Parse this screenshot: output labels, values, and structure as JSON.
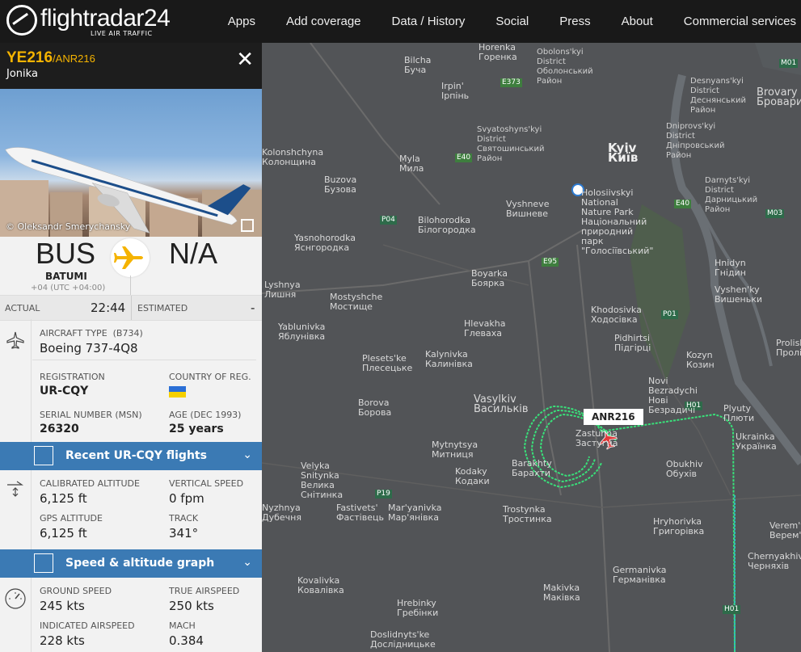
{
  "nav": {
    "logo_text": "flightradar24",
    "logo_sub": "LIVE AIR TRAFFIC",
    "links": [
      "Apps",
      "Add coverage",
      "Data / History",
      "Social",
      "Press",
      "About",
      "Commercial services"
    ]
  },
  "flight": {
    "callsign": "YE216",
    "alt_callsign": "/ANR216",
    "operator": "Jonika",
    "photo_credit": "© Oleksandr Smerychansky",
    "origin_code": "BUS",
    "origin_city": "BATUMI",
    "origin_tz": "+04 (UTC +04:00)",
    "dest_code": "N/A",
    "actual_label": "ACTUAL",
    "actual_time": "22:44",
    "estimated_label": "ESTIMATED",
    "estimated_time": "-"
  },
  "aircraft": {
    "type_label": "AIRCRAFT TYPE",
    "type_code": "(B734)",
    "type_value": "Boeing 737-4Q8",
    "registration_label": "REGISTRATION",
    "registration": "UR-CQY",
    "country_label": "COUNTRY OF REG.",
    "msn_label": "SERIAL NUMBER (MSN)",
    "msn": "26320",
    "age_label": "AGE (DEC 1993)",
    "age": "25 years"
  },
  "recent_flights_bar": "Recent UR-CQY flights",
  "altitude": {
    "cal_alt_label": "CALIBRATED ALTITUDE",
    "cal_alt": "6,125 ft",
    "vs_label": "VERTICAL SPEED",
    "vs": "0 fpm",
    "gps_alt_label": "GPS ALTITUDE",
    "gps_alt": "6,125 ft",
    "track_label": "TRACK",
    "track": "341°"
  },
  "graph_bar": "Speed & altitude graph",
  "speed": {
    "gs_label": "GROUND SPEED",
    "gs": "245 kts",
    "tas_label": "TRUE AIRSPEED",
    "tas": "250 kts",
    "ias_label": "INDICATED AIRSPEED",
    "ias": "228 kts",
    "mach_label": "MACH",
    "mach": "0.384"
  },
  "map": {
    "aircraft_label": "ANR216",
    "places": [
      {
        "t": "Horenka\nГоренка"
      },
      {
        "t": "Obolons'kyi\nDistrict\nОболонський\nРайон"
      },
      {
        "t": "Desnyans'kyi\nDistrict\nДеснянський\nРайон"
      },
      {
        "t": "Brovary\nБровари"
      },
      {
        "t": "Bilcha\nБуча"
      },
      {
        "t": "Irpin'\nІрпінь"
      },
      {
        "t": "Svyatoshyns'kyi\nDistrict\nСвятошинський\nРайон"
      },
      {
        "t": "Kyiv\nКиїв"
      },
      {
        "t": "Dniprovs'kyi\nDistrict\nДніпровський\nРайон"
      },
      {
        "t": "Holosiivskyi\nNational\nNature Park\nНаціональний\nприродний\nпарк\n\"Голосіївський\""
      },
      {
        "t": "Vyshneve\nВишневе"
      },
      {
        "t": "Buzova\nБузова"
      },
      {
        "t": "Myla\nМила"
      },
      {
        "t": "Kolonshchyna\nКолонщина"
      },
      {
        "t": "Bilohorodka\nБілогородка"
      },
      {
        "t": "Yasnohorodka\nЯснгородка"
      },
      {
        "t": "Boyarka\nБоярка"
      },
      {
        "t": "Lyshnya\nЛишня"
      },
      {
        "t": "Mostyshche\nМостище"
      },
      {
        "t": "Khodosivka\nХодосівка"
      },
      {
        "t": "Yablunivka\nЯблунівка"
      },
      {
        "t": "Hlevakha\nГлеваха"
      },
      {
        "t": "Pidhirtsi\nПідгірці"
      },
      {
        "t": "Plesets'ke\nПлесецьке"
      },
      {
        "t": "Kalynivka\nКалинівка"
      },
      {
        "t": "Kozyn\nКозин"
      },
      {
        "t": "Novi\nBezradychi\nНові\nБезрадичі"
      },
      {
        "t": "Borova\nБорова"
      },
      {
        "t": "Vasylkiv\nВасильків"
      },
      {
        "t": "Plyuty\nПлюти"
      },
      {
        "t": "Ukrainka\nУкраїнка"
      },
      {
        "t": "Mytnytsya\nМитниця"
      },
      {
        "t": "Zastuhna\nЗастугна"
      },
      {
        "t": "Barakhty\nБарахти"
      },
      {
        "t": "Velyka\nSnitynka\nВелика\nСнітинка"
      },
      {
        "t": "Kodaky\nКодаки"
      },
      {
        "t": "Obukhiv\nОбухів"
      },
      {
        "t": "Fastivets'\nФастівець"
      },
      {
        "t": "Mar'yanivka\nМар'янівка"
      },
      {
        "t": "Trostynka\nТростинка"
      },
      {
        "t": "Nyzhnya\nДубечня"
      },
      {
        "t": "Hryhorivka\nГригорівка"
      },
      {
        "t": "Germanivka\nГерманівка"
      },
      {
        "t": "Chernyakhiv\nЧерняхів"
      },
      {
        "t": "Kovalivka\nКовалівка"
      },
      {
        "t": "Makivka\nМаківка"
      },
      {
        "t": "Hrebinky\nГребінки"
      },
      {
        "t": "Doslidnyts'ke\nДослідницьке"
      },
      {
        "t": "Hnidyn\nГнідин"
      },
      {
        "t": "Vyshen'ky\nВишеньки"
      },
      {
        "t": "Darnyts'kyi\nDistrict\nДарницький\nРайон"
      },
      {
        "t": "Prolisky\nПроліски"
      },
      {
        "t": "Verem'ya\nВерем'я"
      }
    ],
    "roads": [
      "M01",
      "E373",
      "E40",
      "M03",
      "P04",
      "E95",
      "P01",
      "H01",
      "P19",
      "E40"
    ]
  },
  "colors": {
    "track": "#39e07a",
    "aircraft": "#e03a3a",
    "accent": "#f5b300",
    "bar": "#3b7ab4"
  }
}
